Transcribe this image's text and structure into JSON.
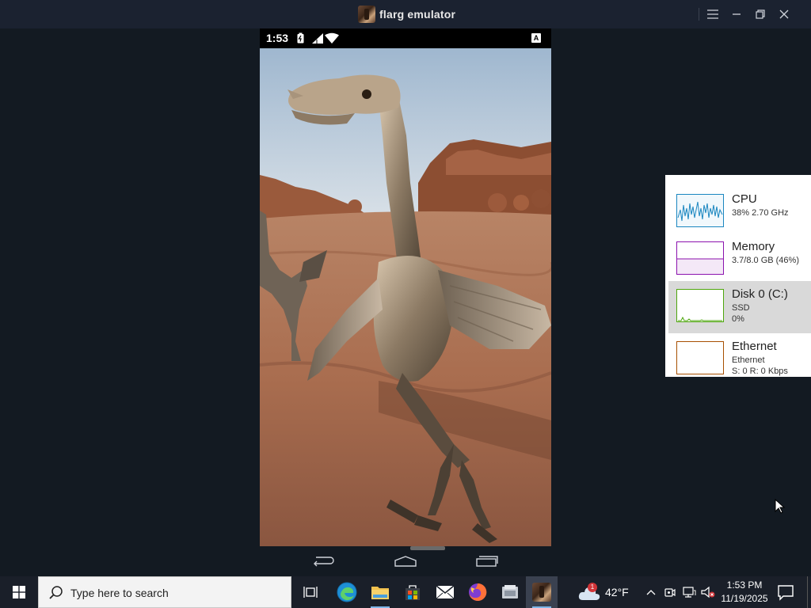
{
  "window": {
    "title": "flarg emulator",
    "icon": "flarg-app-icon",
    "controls": [
      "menu-icon",
      "minimize-icon",
      "restore-icon",
      "close-icon"
    ]
  },
  "phone": {
    "status_bar": {
      "time": "1:53",
      "indicator": "A",
      "icons": [
        "battery-saver-icon",
        "cellular-signal-icon",
        "wifi-icon",
        "keyboard-indicator-icon"
      ]
    },
    "wallpaper": "creature-in-desert-image",
    "nav_bar": [
      "back-icon",
      "home-icon",
      "recents-icon"
    ]
  },
  "performance": {
    "items": [
      {
        "title": "CPU",
        "line1": "38%  2.70 GHz",
        "line2": "",
        "color": "#1a86c0"
      },
      {
        "title": "Memory",
        "line1": "3.7/8.0 GB (46%)",
        "line2": "",
        "color": "#8b12ae"
      },
      {
        "title": "Disk 0 (C:)",
        "line1": "SSD",
        "line2": "0%",
        "color": "#4da60c"
      },
      {
        "title": "Ethernet",
        "line1": "Ethernet",
        "line2": "S: 0  R: 0 Kbps",
        "color": "#a74f01"
      }
    ],
    "selected_index": 2
  },
  "taskbar": {
    "search_placeholder": "Type here to search",
    "apps": [
      "task-view-icon",
      "edge-icon",
      "file-explorer-icon",
      "store-icon",
      "mail-icon",
      "firefox-icon",
      "unknown-app-icon",
      "flarg-emulator-icon"
    ],
    "weather": {
      "temp": "42°F",
      "badge": "1"
    },
    "tray": [
      "chevron-up-icon",
      "meet-now-icon",
      "network-icon",
      "volume-muted-icon"
    ],
    "clock": {
      "time": "1:53 PM",
      "date": "11/19/2025"
    }
  }
}
